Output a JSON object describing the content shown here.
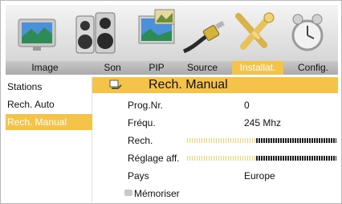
{
  "tabs": [
    "Image",
    "Son",
    "PIP",
    "Source",
    "Installat.",
    "Config."
  ],
  "active_tab": "Installat.",
  "sidebar": [
    {
      "label": "Stations"
    },
    {
      "label": "Rech. Auto"
    },
    {
      "label": "Rech. Manual"
    }
  ],
  "active_sidebar": "Rech. Manual",
  "panel": {
    "title": "Rech. Manual",
    "rows": [
      {
        "label": "Prog.Nr.",
        "value": "0"
      },
      {
        "label": "Fréqu.",
        "value": "245  Mhz"
      },
      {
        "label": "Rech.",
        "level": 0.48
      },
      {
        "label": "Réglage aff.",
        "level": 0.48
      },
      {
        "label": "Pays",
        "value": "Europe"
      }
    ],
    "save_label": "Mémoriser"
  },
  "colors": {
    "accent": "#f5c24a",
    "bar_inactive": "#f4d068",
    "bar_active": "#222222"
  },
  "icons": [
    "tv-screen-icon",
    "speakers-icon",
    "pip-windows-icon",
    "source-cable-icon",
    "tools-icon",
    "alarm-clock-icon",
    "folder-icon"
  ]
}
